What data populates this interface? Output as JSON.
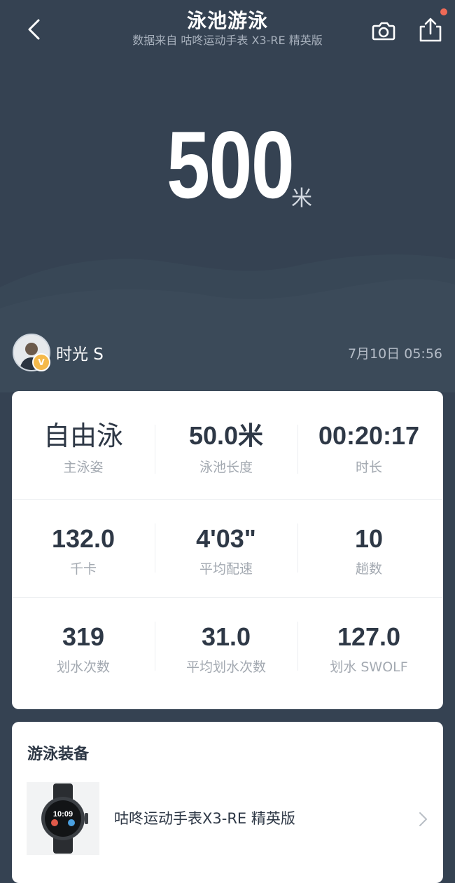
{
  "header": {
    "title": "泳池游泳",
    "subtitle": "数据来自 咕咚运动手表 X3-RE 精英版",
    "back_icon": "chevron-left-icon",
    "camera_icon": "camera-icon",
    "share_icon": "share-icon"
  },
  "summary": {
    "distance": "500",
    "unit": "米"
  },
  "user": {
    "name": "时光 S",
    "badge": "V",
    "date": "7月10日 05:56"
  },
  "stats": [
    [
      {
        "value": "自由泳",
        "label": "主泳姿"
      },
      {
        "value": "50.0米",
        "label": "泳池长度"
      },
      {
        "value": "00:20:17",
        "label": "时长"
      }
    ],
    [
      {
        "value": "132.0",
        "label": "千卡"
      },
      {
        "value": "4'03\"",
        "label": "平均配速"
      },
      {
        "value": "10",
        "label": "趟数"
      }
    ],
    [
      {
        "value": "319",
        "label": "划水次数"
      },
      {
        "value": "31.0",
        "label": "平均划水次数"
      },
      {
        "value": "127.0",
        "label": "划水 SWOLF"
      }
    ]
  ],
  "equipment": {
    "title": "游泳装备",
    "item_name": "咕咚运动手表X3-RE 精英版",
    "watch_time": "10:09"
  },
  "colors": {
    "background": "#354252",
    "card": "#ffffff",
    "accent_dot": "#ef6a57",
    "badge": "#f5b94a"
  }
}
